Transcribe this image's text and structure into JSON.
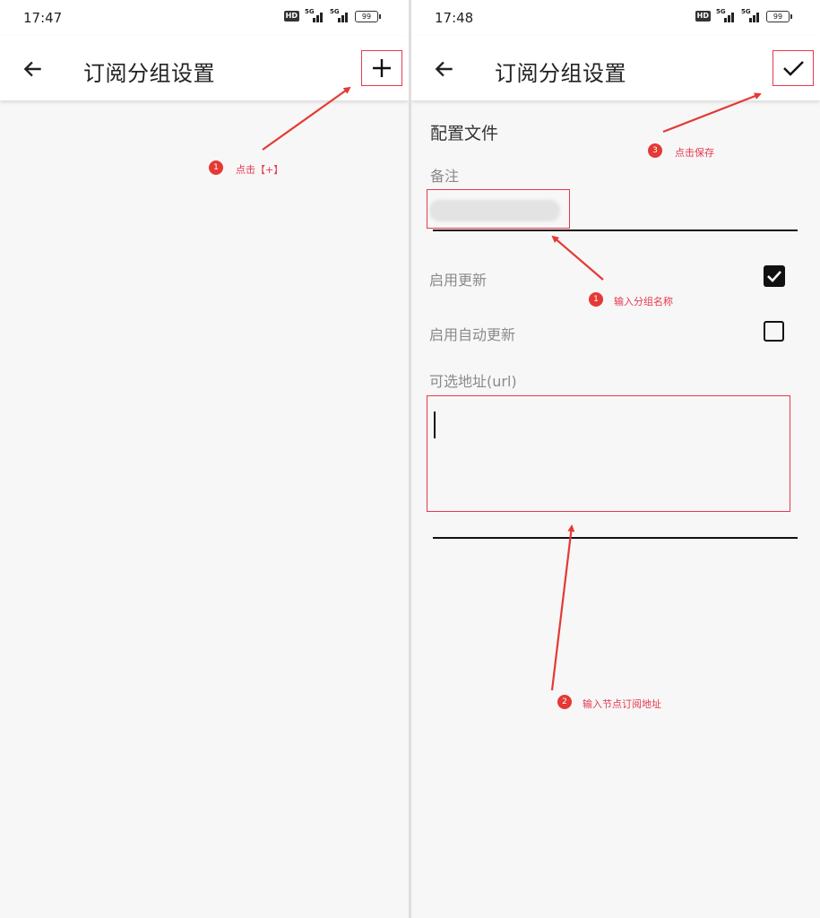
{
  "left": {
    "status": {
      "time": "17:47",
      "hd": "HD",
      "net1": "5G",
      "net2": "5G",
      "battery": "99"
    },
    "appbar": {
      "title": "订阅分组设置"
    },
    "annotation": {
      "badge": "1",
      "text": "点击【+】"
    }
  },
  "right": {
    "status": {
      "time": "17:48",
      "hd": "HD",
      "net1": "5G",
      "net2": "5G",
      "battery": "99"
    },
    "appbar": {
      "title": "订阅分组设置"
    },
    "form": {
      "section_title": "配置文件",
      "remark_label": "备注",
      "enable_update_label": "启用更新",
      "auto_update_label": "启用自动更新",
      "url_label": "可选地址(url)",
      "enable_update_checked": true,
      "auto_update_checked": false
    },
    "annotations": [
      {
        "badge": "1",
        "text": "输入分组名称"
      },
      {
        "badge": "2",
        "text": "输入节点订阅地址"
      },
      {
        "badge": "3",
        "text": "点击保存"
      }
    ]
  },
  "colors": {
    "annotation_red": "#e8384f",
    "text_dark": "#222222",
    "label_gray": "#8a8a8a",
    "background": "#f7f7f7"
  },
  "icons": {
    "back": "arrow-left-icon",
    "add": "plus-icon",
    "save": "check-icon",
    "checked": "checkbox-checked-icon",
    "unchecked": "checkbox-empty-icon"
  }
}
